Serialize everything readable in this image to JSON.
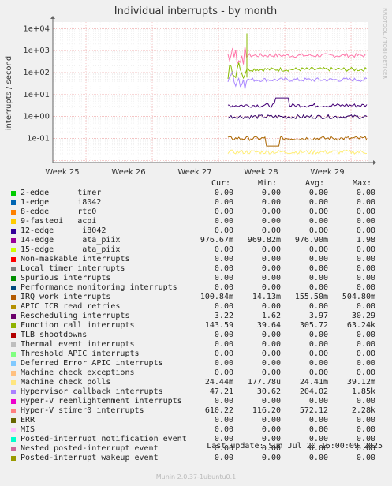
{
  "chart_data": {
    "type": "line",
    "title": "Individual interrupts - by month",
    "ylabel": "interrupts / second",
    "side_label": "RRDTOOL / TOBI OETIKER",
    "yscale": "log",
    "ylim": [
      0.008,
      20000
    ],
    "yticks": [
      "1e+04",
      "1e+03",
      "1e+02",
      "1e+01",
      "1e+00",
      "1e-01"
    ],
    "xticks": [
      "Week 25",
      "Week 26",
      "Week 27",
      "Week 28",
      "Week 29"
    ],
    "data_start_fraction": 0.555,
    "series": [
      {
        "name": "Hyper-V stimer0 interrupts",
        "color": "#ff77aa",
        "level": 600
      },
      {
        "name": "Function call interrupts",
        "color": "#88bb00",
        "level": 140
      },
      {
        "name": "Hypervisor callback interrupts",
        "color": "#aa88ff",
        "level": 47
      },
      {
        "name": "Rescheduling interrupts",
        "color": "#440077",
        "level": 3.2
      },
      {
        "name": "14-edge ata_piix",
        "color": "#330066",
        "level": 0.98
      },
      {
        "name": "IRQ work interrupts",
        "color": "#aa6600",
        "level": 0.1
      },
      {
        "name": "Machine check polls",
        "color": "#ffee77",
        "level": 0.024
      }
    ]
  },
  "legend": {
    "headers": {
      "cur": "Cur:",
      "min": "Min:",
      "avg": "Avg:",
      "max": "Max:"
    },
    "rows": [
      {
        "name": "2-edge      timer",
        "color": "#00cc00",
        "cur": "0.00",
        "min": "0.00",
        "avg": "0.00",
        "max": "0.00"
      },
      {
        "name": "1-edge      i8042",
        "color": "#0066b3",
        "cur": "0.00",
        "min": "0.00",
        "avg": "0.00",
        "max": "0.00"
      },
      {
        "name": "8-edge      rtc0",
        "color": "#ff8000",
        "cur": "0.00",
        "min": "0.00",
        "avg": "0.00",
        "max": "0.00"
      },
      {
        "name": "9-fasteoi   acpi",
        "color": "#ffcc00",
        "cur": "0.00",
        "min": "0.00",
        "avg": "0.00",
        "max": "0.00"
      },
      {
        "name": "12-edge      i8042",
        "color": "#330099",
        "cur": "0.00",
        "min": "0.00",
        "avg": "0.00",
        "max": "0.00"
      },
      {
        "name": "14-edge      ata_piix",
        "color": "#990099",
        "cur": "976.67m",
        "min": "969.82m",
        "avg": "976.90m",
        "max": "1.98"
      },
      {
        "name": "15-edge      ata_piix",
        "color": "#ccff00",
        "cur": "0.00",
        "min": "0.00",
        "avg": "0.00",
        "max": "0.00"
      },
      {
        "name": "Non-maskable interrupts",
        "color": "#ff0000",
        "cur": "0.00",
        "min": "0.00",
        "avg": "0.00",
        "max": "0.00"
      },
      {
        "name": "Local timer interrupts",
        "color": "#808080",
        "cur": "0.00",
        "min": "0.00",
        "avg": "0.00",
        "max": "0.00"
      },
      {
        "name": "Spurious interrupts",
        "color": "#008f00",
        "cur": "0.00",
        "min": "0.00",
        "avg": "0.00",
        "max": "0.00"
      },
      {
        "name": "Performance monitoring interrupts",
        "color": "#00487d",
        "cur": "0.00",
        "min": "0.00",
        "avg": "0.00",
        "max": "0.00"
      },
      {
        "name": "IRQ work interrupts",
        "color": "#b35a00",
        "cur": "100.84m",
        "min": "14.13m",
        "avg": "155.50m",
        "max": "504.80m"
      },
      {
        "name": "APIC ICR read retries",
        "color": "#b38f00",
        "cur": "0.00",
        "min": "0.00",
        "avg": "0.00",
        "max": "0.00"
      },
      {
        "name": "Rescheduling interrupts",
        "color": "#6b006b",
        "cur": "3.22",
        "min": "1.62",
        "avg": "3.97",
        "max": "30.29"
      },
      {
        "name": "Function call interrupts",
        "color": "#8fb300",
        "cur": "143.59",
        "min": "39.64",
        "avg": "305.72",
        "max": "63.24k"
      },
      {
        "name": "TLB shootdowns",
        "color": "#b30000",
        "cur": "0.00",
        "min": "0.00",
        "avg": "0.00",
        "max": "0.00"
      },
      {
        "name": "Thermal event interrupts",
        "color": "#bebebe",
        "cur": "0.00",
        "min": "0.00",
        "avg": "0.00",
        "max": "0.00"
      },
      {
        "name": "Threshold APIC interrupts",
        "color": "#80ff80",
        "cur": "0.00",
        "min": "0.00",
        "avg": "0.00",
        "max": "0.00"
      },
      {
        "name": "Deferred Error APIC interrupts",
        "color": "#80c9ff",
        "cur": "0.00",
        "min": "0.00",
        "avg": "0.00",
        "max": "0.00"
      },
      {
        "name": "Machine check exceptions",
        "color": "#ffc080",
        "cur": "0.00",
        "min": "0.00",
        "avg": "0.00",
        "max": "0.00"
      },
      {
        "name": "Machine check polls",
        "color": "#ffe680",
        "cur": "24.44m",
        "min": "177.78u",
        "avg": "24.41m",
        "max": "39.12m"
      },
      {
        "name": "Hypervisor callback interrupts",
        "color": "#aa80ff",
        "cur": "47.21",
        "min": "30.62",
        "avg": "204.02",
        "max": "1.85k"
      },
      {
        "name": "Hyper-V reenlightenment interrupts",
        "color": "#ee00cc",
        "cur": "0.00",
        "min": "0.00",
        "avg": "0.00",
        "max": "0.00"
      },
      {
        "name": "Hyper-V stimer0 interrupts",
        "color": "#ff8080",
        "cur": "610.22",
        "min": "116.20",
        "avg": "572.12",
        "max": "2.28k"
      },
      {
        "name": "ERR",
        "color": "#666600",
        "cur": "0.00",
        "min": "0.00",
        "avg": "0.00",
        "max": "0.00"
      },
      {
        "name": "MIS",
        "color": "#ffbfff",
        "cur": "0.00",
        "min": "0.00",
        "avg": "0.00",
        "max": "0.00"
      },
      {
        "name": "Posted-interrupt notification event",
        "color": "#00ffcc",
        "cur": "0.00",
        "min": "0.00",
        "avg": "0.00",
        "max": "0.00"
      },
      {
        "name": "Nested posted-interrupt event",
        "color": "#cc6699",
        "cur": "0.00",
        "min": "0.00",
        "avg": "0.00",
        "max": "0.00"
      },
      {
        "name": "Posted-interrupt wakeup event",
        "color": "#999900",
        "cur": "0.00",
        "min": "0.00",
        "avg": "0.00",
        "max": "0.00"
      }
    ]
  },
  "footer": {
    "last_update": "Last update: Sun Jul 20 16:00:09 2025",
    "munin": "Munin 2.0.37-1ubuntu0.1"
  }
}
